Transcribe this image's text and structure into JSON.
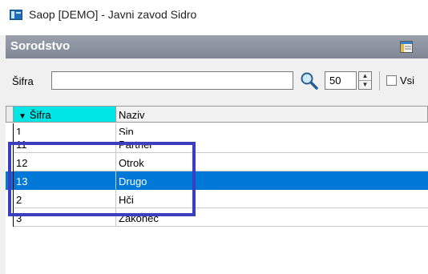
{
  "window": {
    "title": "Saop  [DEMO] - Javni zavod Sidro",
    "icon": "app-window-icon"
  },
  "panel": {
    "title": "Sorodstvo",
    "layout_icon": "layout-settings-icon"
  },
  "search": {
    "label": "Šifra",
    "value": "",
    "search_icon": "magnifier-icon",
    "count": "50",
    "checkbox_label": "Vsi",
    "checkbox_checked": false
  },
  "grid": {
    "columns": [
      {
        "label": "Šifra",
        "sorted": "desc"
      },
      {
        "label": "Naziv"
      }
    ],
    "rows": [
      {
        "sifra": "1",
        "naziv": "Sin"
      },
      {
        "sifra": "11",
        "naziv": "Partner"
      },
      {
        "sifra": "12",
        "naziv": "Otrok"
      },
      {
        "sifra": "13",
        "naziv": "Drugo",
        "selected": true
      },
      {
        "sifra": "2",
        "naziv": "Hči"
      },
      {
        "sifra": "3",
        "naziv": "Zakonec"
      }
    ]
  },
  "colors": {
    "selection": "#0078d7",
    "sorted_header": "#00e5e5",
    "annotation_box": "#3d3dbf"
  }
}
